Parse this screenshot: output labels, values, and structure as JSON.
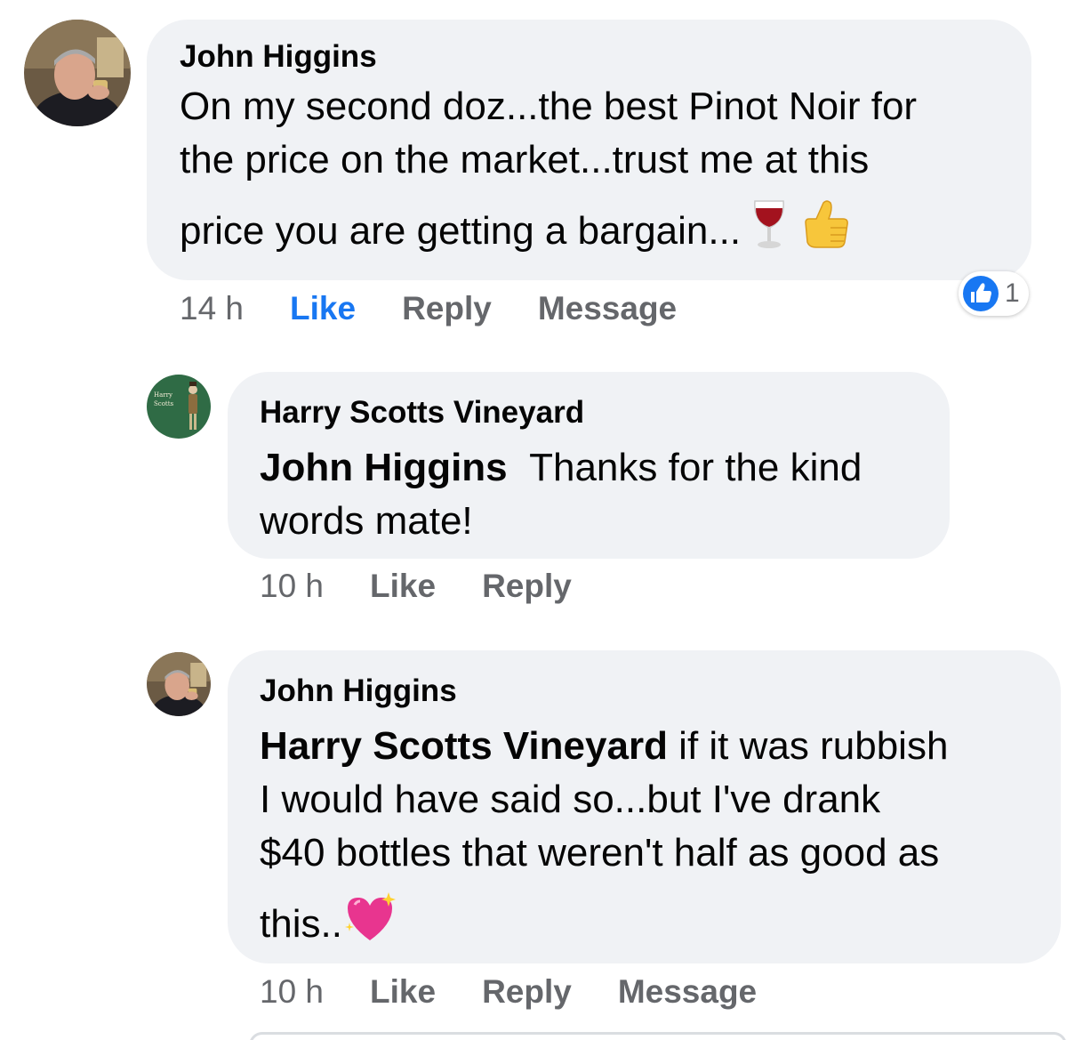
{
  "comments": [
    {
      "author": "John Higgins",
      "line1": "On my second doz...the best Pinot Noir for",
      "line2": "the price on the market...trust me at this",
      "line3": "price you are getting a bargain...",
      "emojis": [
        "wine-glass",
        "thumbs-up"
      ],
      "time": "14 h",
      "like_label": "Like",
      "reply_label": "Reply",
      "message_label": "Message",
      "reaction_count": "1"
    },
    {
      "author": "Harry Scotts Vineyard",
      "avatar_text_1": "Harry",
      "avatar_text_2": "Scotts",
      "mention": "John Higgins",
      "line1": "Thanks for the kind",
      "line2": "words mate!",
      "time": "10 h",
      "like_label": "Like",
      "reply_label": "Reply"
    },
    {
      "author": "John Higgins",
      "mention": "Harry Scotts Vineyard",
      "line1": " if it was rubbish",
      "line2": "I would have said so...but I've drank",
      "line3": "$40 bottles that weren't half as good as",
      "line4": "this..",
      "emojis": [
        "sparkling-heart"
      ],
      "time": "10 h",
      "like_label": "Like",
      "reply_label": "Reply",
      "message_label": "Message"
    }
  ],
  "colors": {
    "bubble": "#f0f2f5",
    "like_active": "#1877f2",
    "muted": "#65676b",
    "vineyard_green": "#2f6b45"
  }
}
